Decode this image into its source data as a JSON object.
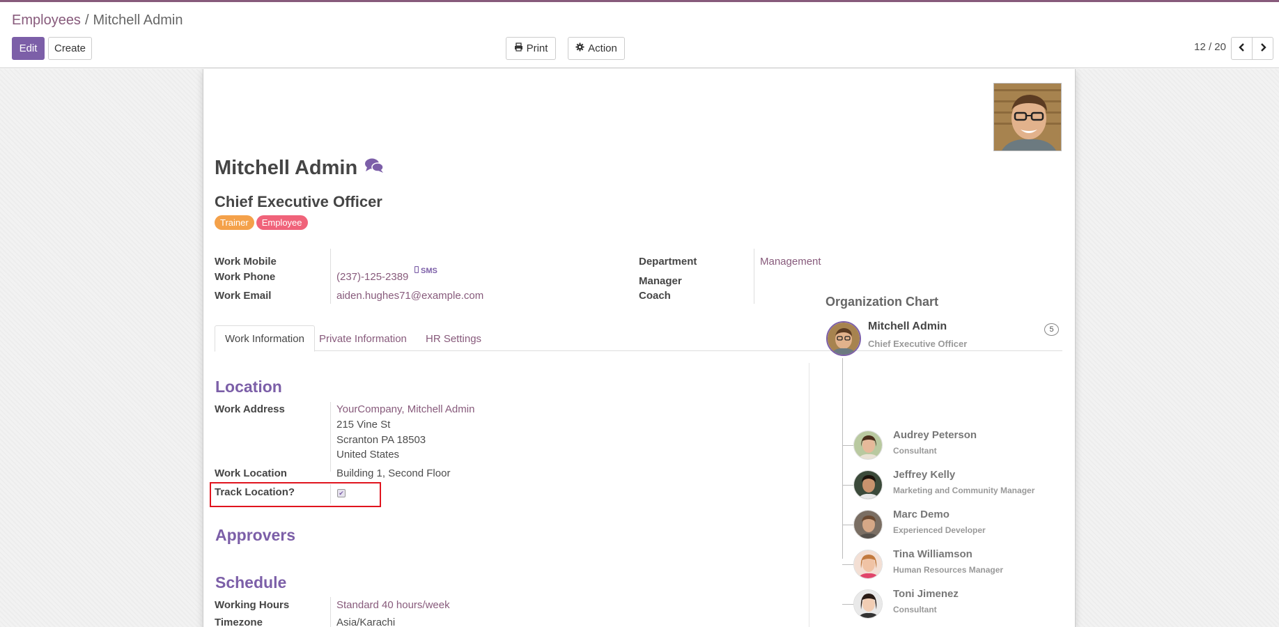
{
  "breadcrumb": {
    "parent": "Employees",
    "separator": "/",
    "current": "Mitchell Admin"
  },
  "toolbar": {
    "edit_label": "Edit",
    "create_label": "Create",
    "print_label": "Print",
    "action_label": "Action"
  },
  "pager": {
    "value": "12 / 20"
  },
  "employee": {
    "name": "Mitchell Admin",
    "job_title": "Chief Executive Officer",
    "tags": [
      {
        "label": "Trainer",
        "color": "#f4a14a"
      },
      {
        "label": "Employee",
        "color": "#f0637a"
      }
    ]
  },
  "contact": {
    "work_mobile_label": "Work Mobile",
    "work_phone_label": "Work Phone",
    "work_phone_value": "(237)-125-2389",
    "sms_label": "SMS",
    "work_email_label": "Work Email",
    "work_email_value": "aiden.hughes71@example.com",
    "department_label": "Department",
    "department_value": "Management",
    "manager_label": "Manager",
    "coach_label": "Coach"
  },
  "tabs": [
    {
      "label": "Work Information",
      "active": true
    },
    {
      "label": "Private Information",
      "active": false
    },
    {
      "label": "HR Settings",
      "active": false
    }
  ],
  "location": {
    "title": "Location",
    "work_address_label": "Work Address",
    "address_company": "YourCompany, Mitchell Admin",
    "address_street": "215 Vine St",
    "address_city": "Scranton PA 18503",
    "address_country": "United States",
    "work_location_label": "Work Location",
    "work_location_value": "Building 1, Second Floor",
    "track_location_label": "Track Location?",
    "track_location_checked": true
  },
  "approvers": {
    "title": "Approvers"
  },
  "schedule": {
    "title": "Schedule",
    "working_hours_label": "Working Hours",
    "working_hours_value": "Standard 40 hours/week",
    "timezone_label": "Timezone",
    "timezone_value": "Asia/Karachi"
  },
  "org_chart": {
    "title": "Organization Chart",
    "main": {
      "name": "Mitchell Admin",
      "role": "Chief Executive Officer",
      "count": "5"
    },
    "subordinates": [
      {
        "name": "Audrey Peterson",
        "role": "Consultant"
      },
      {
        "name": "Jeffrey Kelly",
        "role": "Marketing and Community Manager"
      },
      {
        "name": "Marc Demo",
        "role": "Experienced Developer"
      },
      {
        "name": "Tina Williamson",
        "role": "Human Resources Manager"
      },
      {
        "name": "Toni Jimenez",
        "role": "Consultant"
      }
    ]
  },
  "colors": {
    "brand": "#875a7b",
    "primary_button": "#7c5fa8",
    "highlight_box": "#e0141e"
  }
}
